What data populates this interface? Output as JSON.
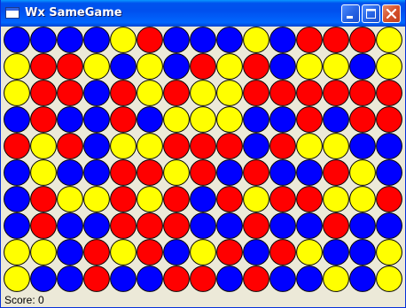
{
  "window": {
    "title": "Wx SameGame"
  },
  "status": {
    "score_text": "Score: 0"
  },
  "colors": {
    "B": "#0000ff",
    "R": "#ff0000",
    "Y": "#ffff00",
    "background": "#ece9d8"
  },
  "board": {
    "rows": 10,
    "cols": 15,
    "grid": [
      "BBBBYRBBBYBRRRY",
      "YRRYBYBRYRBYYBY",
      "YRRBRYRYYRRRRRR",
      "BRBBRBYYYBBRBRR",
      "RYRBYYRRRBRYYBB",
      "BYBBRRYRBRBBRYB",
      "BRYYRYRBRYRRYYR",
      "BRBBRRRBBRBBRBB",
      "YYBRYRBYRBRYBBY",
      "YBBRBBRRBRBBYBY"
    ]
  }
}
